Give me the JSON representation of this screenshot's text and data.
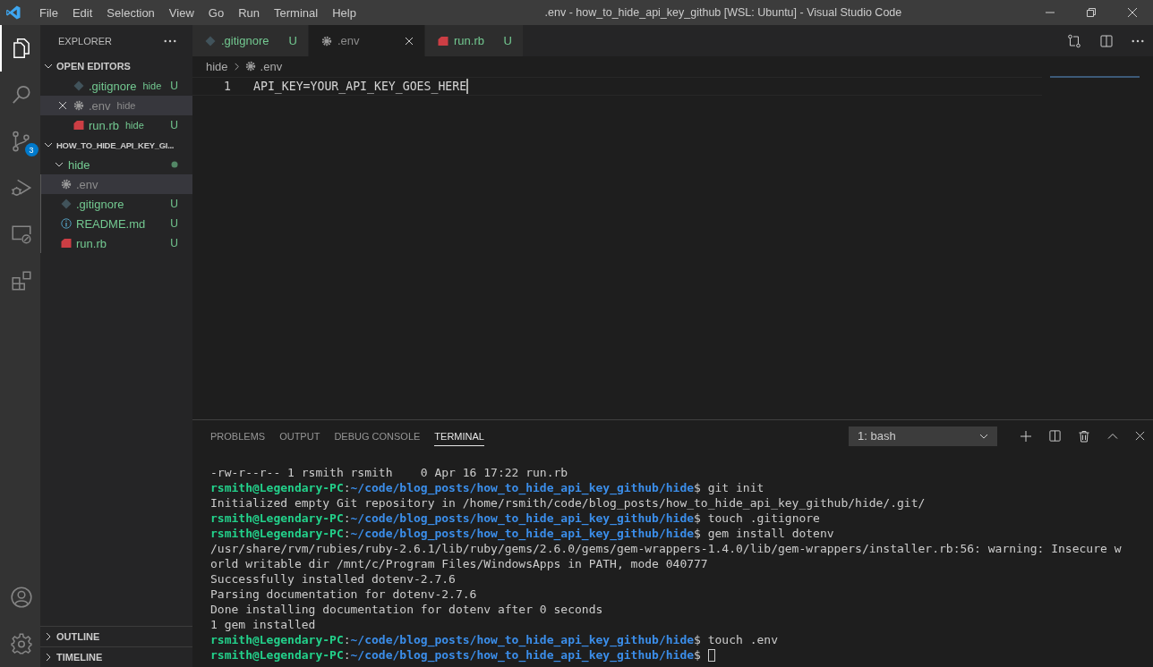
{
  "window": {
    "title": ".env - how_to_hide_api_key_github [WSL: Ubuntu] - Visual Studio Code"
  },
  "menu": [
    "File",
    "Edit",
    "Selection",
    "View",
    "Go",
    "Run",
    "Terminal",
    "Help"
  ],
  "activity_bar": [
    {
      "kind": "files",
      "selected": true
    },
    {
      "kind": "search",
      "selected": false
    },
    {
      "kind": "scm",
      "selected": false,
      "badge": "3"
    },
    {
      "kind": "debug",
      "selected": false
    },
    {
      "kind": "remote",
      "selected": false
    },
    {
      "kind": "extensions",
      "selected": false
    }
  ],
  "activity_bar_bottom": [
    {
      "kind": "account"
    },
    {
      "kind": "settings"
    }
  ],
  "sidebar": {
    "title": "EXPLORER",
    "open_editors": {
      "title": "OPEN EDITORS",
      "expanded": true,
      "items": [
        {
          "name": ".gitignore",
          "kind": "git",
          "folder": "hide",
          "badge": "U",
          "color": "#73c991",
          "selected": false
        },
        {
          "name": ".env",
          "kind": "gear",
          "folder": "hide",
          "color": "#8c8c8c",
          "selected": true
        },
        {
          "name": "run.rb",
          "kind": "ruby",
          "folder": "hide",
          "badge": "U",
          "color": "#73c991",
          "selected": false
        }
      ]
    },
    "folder": {
      "title": "HOW_TO_HIDE_API_KEY_GI...",
      "expanded": true,
      "tree": [
        {
          "name": "hide",
          "expanded": true,
          "color": "#73c991",
          "children": [
            {
              "name": ".env",
              "kind": "gear",
              "color": "#8c8c8c",
              "selected": true
            },
            {
              "name": ".gitignore",
              "kind": "git",
              "badge": "U",
              "color": "#73c991",
              "selected": false
            },
            {
              "name": "README.md",
              "kind": "info",
              "badge": "U",
              "color": "#73c991",
              "selected": false
            },
            {
              "name": "run.rb",
              "kind": "ruby",
              "badge": "U",
              "color": "#73c991",
              "selected": false
            }
          ]
        }
      ]
    },
    "sections": [
      {
        "title": "OUTLINE",
        "expanded": false
      },
      {
        "title": "TIMELINE",
        "expanded": false
      }
    ]
  },
  "tabs": [
    {
      "label": ".gitignore",
      "kind": "git",
      "badge": "U",
      "color": "#73c991",
      "selected": false
    },
    {
      "label": ".env",
      "kind": "gear",
      "color": "#8c8c8c",
      "selected": true
    },
    {
      "label": "run.rb",
      "kind": "ruby",
      "badge": "U",
      "color": "#73c991",
      "selected": false
    }
  ],
  "breadcrumb": {
    "folder": "hide",
    "file": ".env"
  },
  "editor": {
    "lines": [
      {
        "number": "1",
        "text": "API_KEY=YOUR_API_KEY_GOES_HERE"
      }
    ]
  },
  "panel": {
    "tabs": [
      {
        "label": "PROBLEMS",
        "selected": false
      },
      {
        "label": "OUTPUT",
        "selected": false
      },
      {
        "label": "DEBUG CONSOLE",
        "selected": false
      },
      {
        "label": "TERMINAL",
        "selected": true
      }
    ],
    "terminal_select": "1: bash",
    "lines": [
      {
        "kind": "output",
        "text": "-rw-r--r-- 1 rsmith rsmith    0 Apr 16 17:22 run.rb"
      },
      {
        "kind": "prompt",
        "user": "rsmith@Legendary-PC",
        "sep": ":",
        "path": "~/code/blog_posts/how_to_hide_api_key_github/hide",
        "command": "$ git init",
        "cursor": false
      },
      {
        "kind": "output",
        "text": "Initialized empty Git repository in /home/rsmith/code/blog_posts/how_to_hide_api_key_github/hide/.git/"
      },
      {
        "kind": "prompt",
        "user": "rsmith@Legendary-PC",
        "sep": ":",
        "path": "~/code/blog_posts/how_to_hide_api_key_github/hide",
        "command": "$ touch .gitignore",
        "cursor": false
      },
      {
        "kind": "prompt",
        "user": "rsmith@Legendary-PC",
        "sep": ":",
        "path": "~/code/blog_posts/how_to_hide_api_key_github/hide",
        "command": "$ gem install dotenv",
        "cursor": false
      },
      {
        "kind": "output",
        "text": "/usr/share/rvm/rubies/ruby-2.6.1/lib/ruby/gems/2.6.0/gems/gem-wrappers-1.4.0/lib/gem-wrappers/installer.rb:56: warning: Insecure w"
      },
      {
        "kind": "output",
        "text": "orld writable dir /mnt/c/Program Files/WindowsApps in PATH, mode 040777"
      },
      {
        "kind": "output",
        "text": "Successfully installed dotenv-2.7.6"
      },
      {
        "kind": "output",
        "text": "Parsing documentation for dotenv-2.7.6"
      },
      {
        "kind": "output",
        "text": "Done installing documentation for dotenv after 0 seconds"
      },
      {
        "kind": "output",
        "text": "1 gem installed"
      },
      {
        "kind": "prompt",
        "user": "rsmith@Legendary-PC",
        "sep": ":",
        "path": "~/code/blog_posts/how_to_hide_api_key_github/hide",
        "command": "$ touch .env",
        "cursor": false
      },
      {
        "kind": "prompt",
        "user": "rsmith@Legendary-PC",
        "sep": ":",
        "path": "~/code/blog_posts/how_to_hide_api_key_github/hide",
        "command": "$ ",
        "cursor": true
      }
    ]
  }
}
